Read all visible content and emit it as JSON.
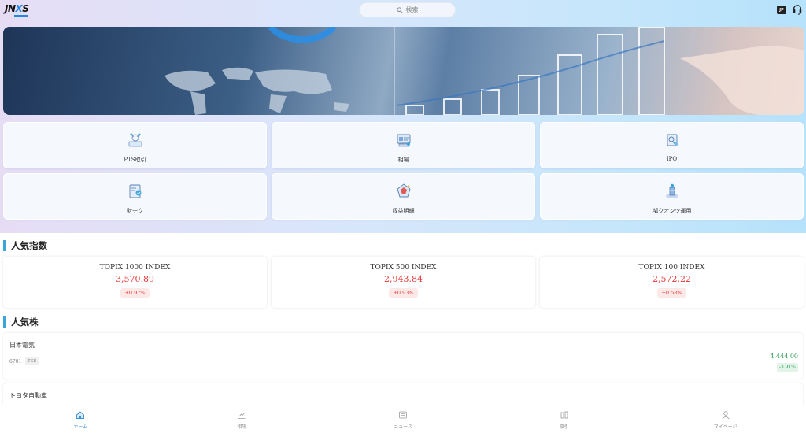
{
  "header": {
    "logo_main": "JN",
    "logo_x": "X",
    "logo_end": "S",
    "search_placeholder": "検索",
    "lang_badge": "JP"
  },
  "tiles": [
    {
      "label": "PTS取引",
      "icon": "pts-trade-icon"
    },
    {
      "label": "相場",
      "icon": "market-icon"
    },
    {
      "label": "IPO",
      "icon": "ipo-icon"
    },
    {
      "label": "財テク",
      "icon": "wealth-icon"
    },
    {
      "label": "収益明細",
      "icon": "earnings-icon"
    },
    {
      "label": "AIクオンツ運用",
      "icon": "ai-quant-icon"
    }
  ],
  "indices_section": {
    "title": "人気指数"
  },
  "indices": [
    {
      "name": "TOPIX 1000 INDEX",
      "value": "3,570.89",
      "change": "+0.97%"
    },
    {
      "name": "TOPIX 500 INDEX",
      "value": "2,943.84",
      "change": "+0.93%"
    },
    {
      "name": "TOPIX 100 INDEX",
      "value": "2,572.22",
      "change": "+0.58%"
    }
  ],
  "stocks_section": {
    "title": "人気株"
  },
  "stocks": [
    {
      "name": "日本電気",
      "code": "6701",
      "exchange": "TSE",
      "price": "4,444.00",
      "change": "-3.91%"
    },
    {
      "name": "トヨタ自動車",
      "code": "",
      "exchange": "",
      "price": "",
      "change": ""
    }
  ],
  "nav": [
    {
      "label": "ホーム",
      "icon": "home-icon",
      "active": true
    },
    {
      "label": "相場",
      "icon": "chart-icon",
      "active": false
    },
    {
      "label": "ニュース",
      "icon": "news-icon",
      "active": false
    },
    {
      "label": "取引",
      "icon": "trade-icon",
      "active": false
    },
    {
      "label": "マイページ",
      "icon": "user-icon",
      "active": false
    }
  ],
  "colors": {
    "accent": "#3aa6d9",
    "up": "#e53935",
    "down": "#2e9e57",
    "nav_active": "#3a8fd9"
  }
}
